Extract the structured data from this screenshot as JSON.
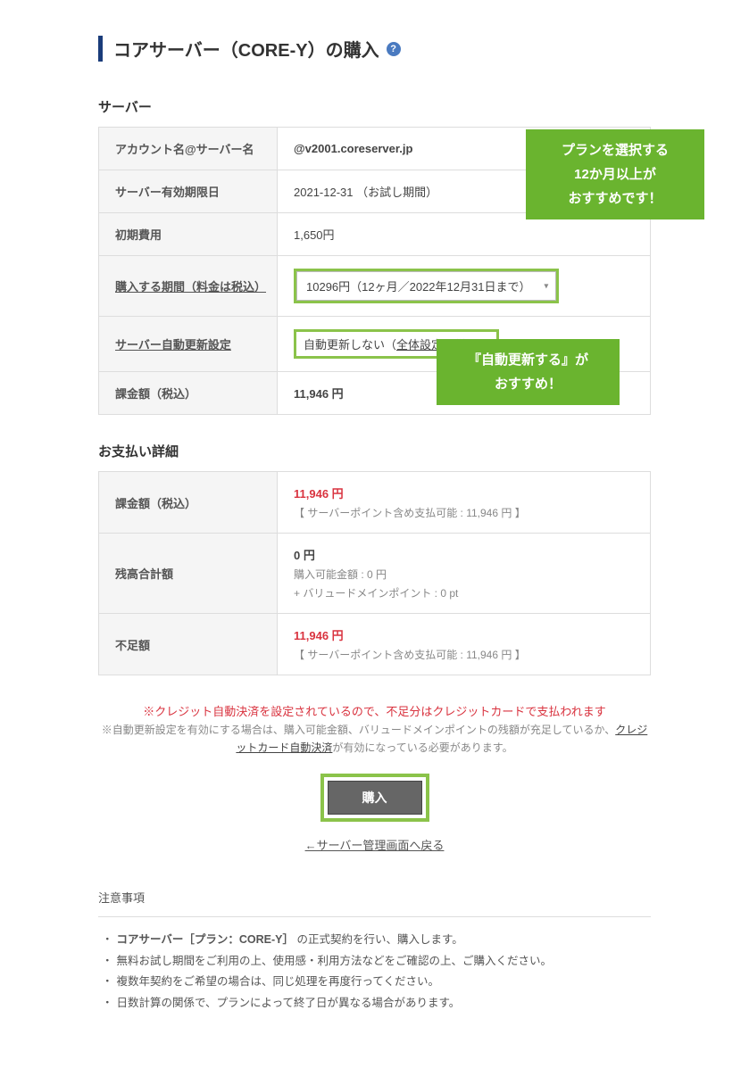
{
  "header": {
    "title": "コアサーバー（CORE-Y）の購入",
    "help_glyph": "?"
  },
  "server_section": {
    "title": "サーバー",
    "rows": {
      "account_label": "アカウント名@サーバー名",
      "account_value": "@v2001.coreserver.jp",
      "expire_label": "サーバー有効期限日",
      "expire_value": "2021-12-31 （お試し期間）",
      "initfee_label": "初期費用",
      "initfee_value": "1,650円",
      "period_label": "購入する期間（料金は税込）",
      "period_value": "10296円（12ヶ月／2022年12月31日まで）",
      "autorenew_label": "サーバー自動更新設定",
      "autorenew_value": "自動更新しない（",
      "autorenew_link": "全体設定に従う",
      "autorenew_suffix": "）",
      "charge_label": "課金額（税込）",
      "charge_value": "11,946 円"
    }
  },
  "callouts": {
    "plan": "プランを選択する\n12か月以上が\nおすすめです！",
    "autorenew": "『自動更新する』が\nおすすめ！"
  },
  "payment_section": {
    "title": "お支払い詳細",
    "rows": {
      "charge_label": "課金額（税込）",
      "charge_value": "11,946 円",
      "charge_sub": "【 サーバーポイント含め支払可能 : 11,946 円 】",
      "balance_label": "残高合計額",
      "balance_value": "0 円",
      "balance_sub1": "購入可能金額 : 0 円",
      "balance_sub2": "+ バリュードメインポイント : 0 pt",
      "shortage_label": "不足額",
      "shortage_value": "11,946 円",
      "shortage_sub": "【 サーバーポイント含め支払可能 : 11,946 円 】"
    }
  },
  "footer_notes": {
    "red": "※クレジット自動決済を設定されているので、不足分はクレジットカードで支払われます",
    "gray_prefix": "※自動更新設定を有効にする場合は、購入可能金額、バリュードメインポイントの残額が充足しているか、",
    "gray_link": "クレジットカード自動決済",
    "gray_suffix": "が有効になっている必要があります。"
  },
  "buttons": {
    "buy": "購入",
    "back": "←サーバー管理画面へ戻る"
  },
  "notice": {
    "title": "注意事項",
    "items": [
      "コアサーバー［プラン：CORE-Y］の正式契約を行い、購入します。",
      "無料お試し期間をご利用の上、使用感・利用方法などをご確認の上、ご購入ください。",
      "複数年契約をご希望の場合は、同じ処理を再度行ってください。",
      "日数計算の関係で、プランによって終了日が異なる場合があります。"
    ],
    "bold_prefix": "コアサーバー［プラン：CORE-Y］"
  }
}
